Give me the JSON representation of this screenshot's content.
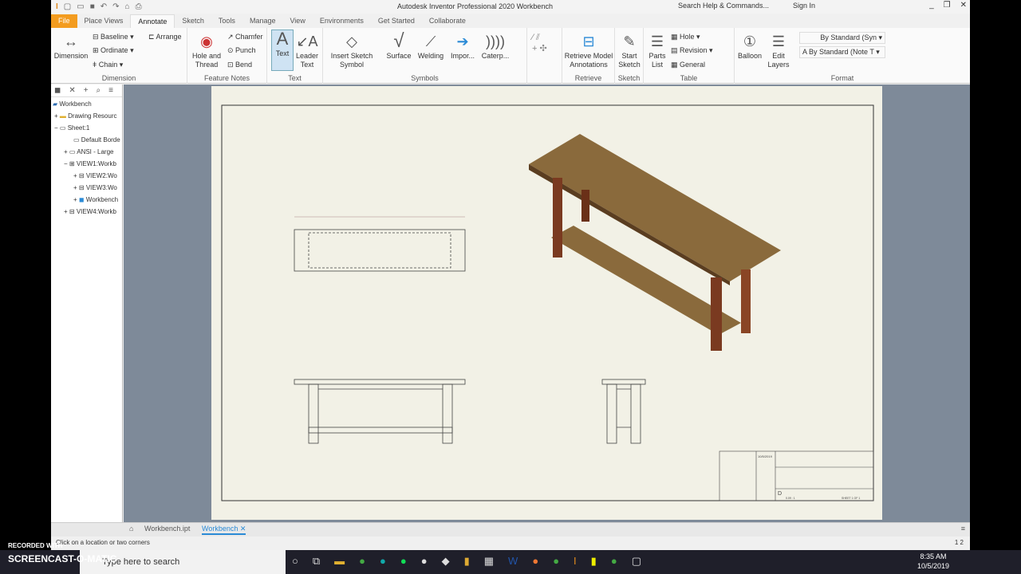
{
  "titlebar": {
    "title": "Autodesk Inventor Professional 2020   Workbench",
    "search": "Search Help & Commands...",
    "signin": "Sign In"
  },
  "tabs": [
    "File",
    "Place Views",
    "Annotate",
    "Sketch",
    "Tools",
    "Manage",
    "View",
    "Environments",
    "Get Started",
    "Collaborate"
  ],
  "ribbon": {
    "dimension": {
      "dimension": "Dimension",
      "baseline": "Baseline",
      "ordinate": "Ordinate",
      "chain": "Chain",
      "arrange": "Arrange",
      "label": "Dimension"
    },
    "feature_notes": {
      "hole": "Hole and Thread",
      "chamfer": "Chamfer",
      "punch": "Punch",
      "bend": "Bend",
      "label": "Feature Notes"
    },
    "text": {
      "text": "Text",
      "leader": "Leader Text",
      "label": "Text"
    },
    "symbols": {
      "insert": "Insert Sketch Symbol",
      "surface": "Surface",
      "welding": "Welding",
      "import": "Impor...",
      "caterpillar": "Caterp...",
      "label": "Symbols"
    },
    "retrieve": {
      "btn": "Retrieve Model Annotations",
      "label": "Retrieve"
    },
    "sketch": {
      "btn": "Start Sketch",
      "label": "Sketch"
    },
    "table": {
      "parts": "Parts List",
      "hole": "Hole",
      "revision": "Revision",
      "general": "General",
      "label": "Table"
    },
    "balloon": "Balloon",
    "layers": "Edit Layers",
    "format": {
      "style1": "By Standard (Syn",
      "style2": "By Standard (Note T",
      "label": "Format"
    }
  },
  "browser": {
    "nodes": [
      "Workbench",
      "Drawing Resourc",
      "Sheet:1",
      "Default Borde",
      "ANSI - Large",
      "VIEW1:Workb",
      "VIEW2:Wo",
      "VIEW3:Wo",
      "Workbench",
      "VIEW4:Workb"
    ]
  },
  "doctabs": {
    "part": "Workbench.ipt",
    "drawing": "Workbench"
  },
  "status": {
    "text": "Click on a location or two corners",
    "pages": "1  2"
  },
  "titleblock": {
    "date": "10/5/2019",
    "size": "D",
    "scale": "0.09 : 1",
    "sheet": "SHEET 1 OF 1"
  },
  "taskbar": {
    "search": "Type here to search",
    "time": "8:35 AM",
    "date": "10/5/2019"
  },
  "watermark": {
    "line1": "RECORDED WITH",
    "line2": "SCREENCAST-O-MATIC"
  }
}
